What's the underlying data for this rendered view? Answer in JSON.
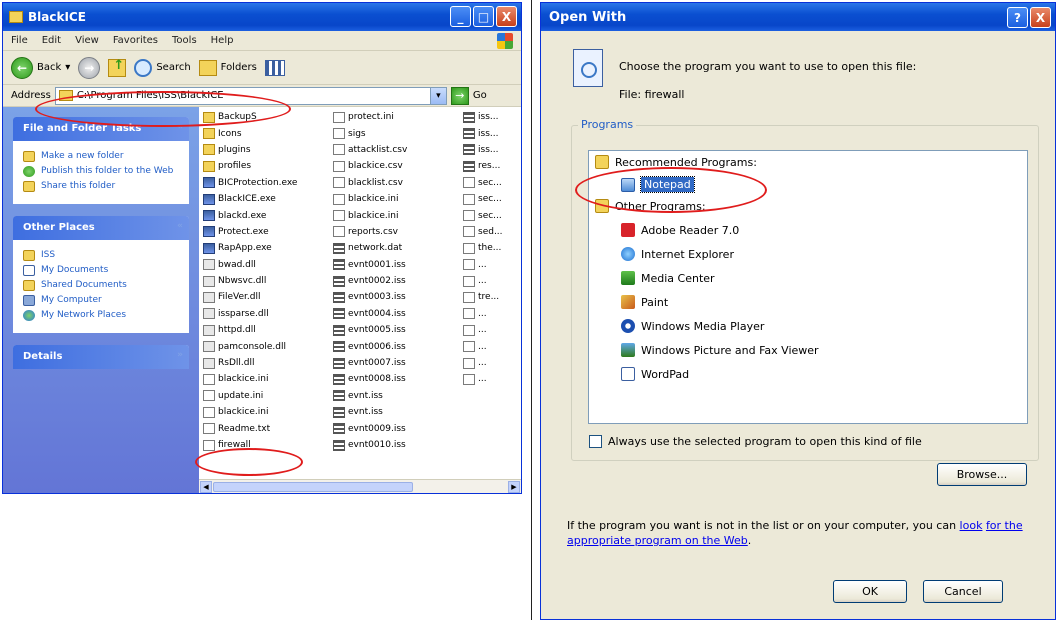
{
  "explorer": {
    "title": "BlackICE",
    "window_buttons": [
      "_",
      "□",
      "X"
    ],
    "menu": [
      "File",
      "Edit",
      "View",
      "Favorites",
      "Tools",
      "Help"
    ],
    "toolbar": {
      "back": "Back",
      "search": "Search",
      "folders": "Folders"
    },
    "address": {
      "label": "Address",
      "path": "C:\\Program Files\\ISS\\BlackICE",
      "go": "Go"
    },
    "task_panes": [
      {
        "title": "File and Folder Tasks",
        "items": [
          "Make a new folder",
          "Publish this folder to the Web",
          "Share this folder"
        ]
      },
      {
        "title": "Other Places",
        "items": [
          "ISS",
          "My Documents",
          "Shared Documents",
          "My Computer",
          "My Network Places"
        ]
      },
      {
        "title": "Details",
        "items": []
      }
    ],
    "files_col1": [
      {
        "name": "BackupS",
        "type": "folder"
      },
      {
        "name": "Icons",
        "type": "folder"
      },
      {
        "name": "plugins",
        "type": "folder"
      },
      {
        "name": "profiles",
        "type": "folder"
      },
      {
        "name": "BICProtection.exe",
        "type": "exe"
      },
      {
        "name": "BlackICE.exe",
        "type": "exe"
      },
      {
        "name": "blackd.exe",
        "type": "exe"
      },
      {
        "name": "Protect.exe",
        "type": "exe"
      },
      {
        "name": "RapApp.exe",
        "type": "exe"
      },
      {
        "name": "bwad.dll",
        "type": "dll"
      },
      {
        "name": "Nbwsvc.dll",
        "type": "dll"
      },
      {
        "name": "FileVer.dll",
        "type": "dll"
      },
      {
        "name": "issparse.dll",
        "type": "dll"
      },
      {
        "name": "httpd.dll",
        "type": "dll"
      },
      {
        "name": "pamconsole.dll",
        "type": "dll"
      },
      {
        "name": "RsDll.dll",
        "type": "dll"
      },
      {
        "name": "blackice.ini",
        "type": "doc"
      },
      {
        "name": "update.ini",
        "type": "doc"
      },
      {
        "name": "blackice.ini",
        "type": "doc"
      },
      {
        "name": "Readme.txt",
        "type": "doc"
      },
      {
        "name": "firewall",
        "type": "doc"
      }
    ],
    "files_col2": [
      {
        "name": "protect.ini",
        "type": "doc"
      },
      {
        "name": "sigs",
        "type": "doc"
      },
      {
        "name": "attacklist.csv",
        "type": "doc"
      },
      {
        "name": "blackice.csv",
        "type": "doc"
      },
      {
        "name": "blacklist.csv",
        "type": "doc"
      },
      {
        "name": "blackice.ini",
        "type": "doc"
      },
      {
        "name": "blackice.ini",
        "type": "doc"
      },
      {
        "name": "reports.csv",
        "type": "doc"
      },
      {
        "name": "network.dat",
        "type": "dat"
      },
      {
        "name": "evnt0001.iss",
        "type": "dat"
      },
      {
        "name": "evnt0002.iss",
        "type": "dat"
      },
      {
        "name": "evnt0003.iss",
        "type": "dat"
      },
      {
        "name": "evnt0004.iss",
        "type": "dat"
      },
      {
        "name": "evnt0005.iss",
        "type": "dat"
      },
      {
        "name": "evnt0006.iss",
        "type": "dat"
      },
      {
        "name": "evnt0007.iss",
        "type": "dat"
      },
      {
        "name": "evnt0008.iss",
        "type": "dat"
      },
      {
        "name": "evnt.iss",
        "type": "dat"
      },
      {
        "name": "evnt.iss",
        "type": "dat"
      },
      {
        "name": "evnt0009.iss",
        "type": "dat"
      },
      {
        "name": "evnt0010.iss",
        "type": "dat"
      }
    ],
    "files_col3": [
      {
        "name": "iss...",
        "type": "dat"
      },
      {
        "name": "iss...",
        "type": "dat"
      },
      {
        "name": "iss...",
        "type": "dat"
      },
      {
        "name": "res...",
        "type": "dat"
      },
      {
        "name": "sec...",
        "type": "doc"
      },
      {
        "name": "sec...",
        "type": "doc"
      },
      {
        "name": "sec...",
        "type": "doc"
      },
      {
        "name": "sed...",
        "type": "doc"
      },
      {
        "name": "the...",
        "type": "doc"
      },
      {
        "name": "...",
        "type": "doc"
      },
      {
        "name": "...",
        "type": "doc"
      },
      {
        "name": "tre...",
        "type": "doc"
      },
      {
        "name": "...",
        "type": "doc"
      },
      {
        "name": "...",
        "type": "doc"
      },
      {
        "name": "...",
        "type": "doc"
      },
      {
        "name": "...",
        "type": "doc"
      },
      {
        "name": "...",
        "type": "doc"
      }
    ]
  },
  "openwith": {
    "title": "Open With",
    "window_buttons": [
      "?",
      "X"
    ],
    "instruction": "Choose the program you want to use to open this file:",
    "file_label": "File:",
    "file_name": "firewall",
    "group_label": "Programs",
    "recommended_header": "Recommended Programs:",
    "recommended": [
      "Notepad"
    ],
    "other_header": "Other Programs:",
    "other": [
      "Adobe Reader 7.0",
      "Internet Explorer",
      "Media Center",
      "Paint",
      "Windows Media Player",
      "Windows Picture and Fax Viewer",
      "WordPad"
    ],
    "always_use": "Always use the selected program to open this kind of file",
    "browse": "Browse...",
    "note_text": "If the program you want is not in the list or on your computer, you can ",
    "note_link_1": "look",
    "note_link_2": "for the appropriate program on the Web",
    "note_end": ".",
    "ok": "OK",
    "cancel": "Cancel"
  }
}
